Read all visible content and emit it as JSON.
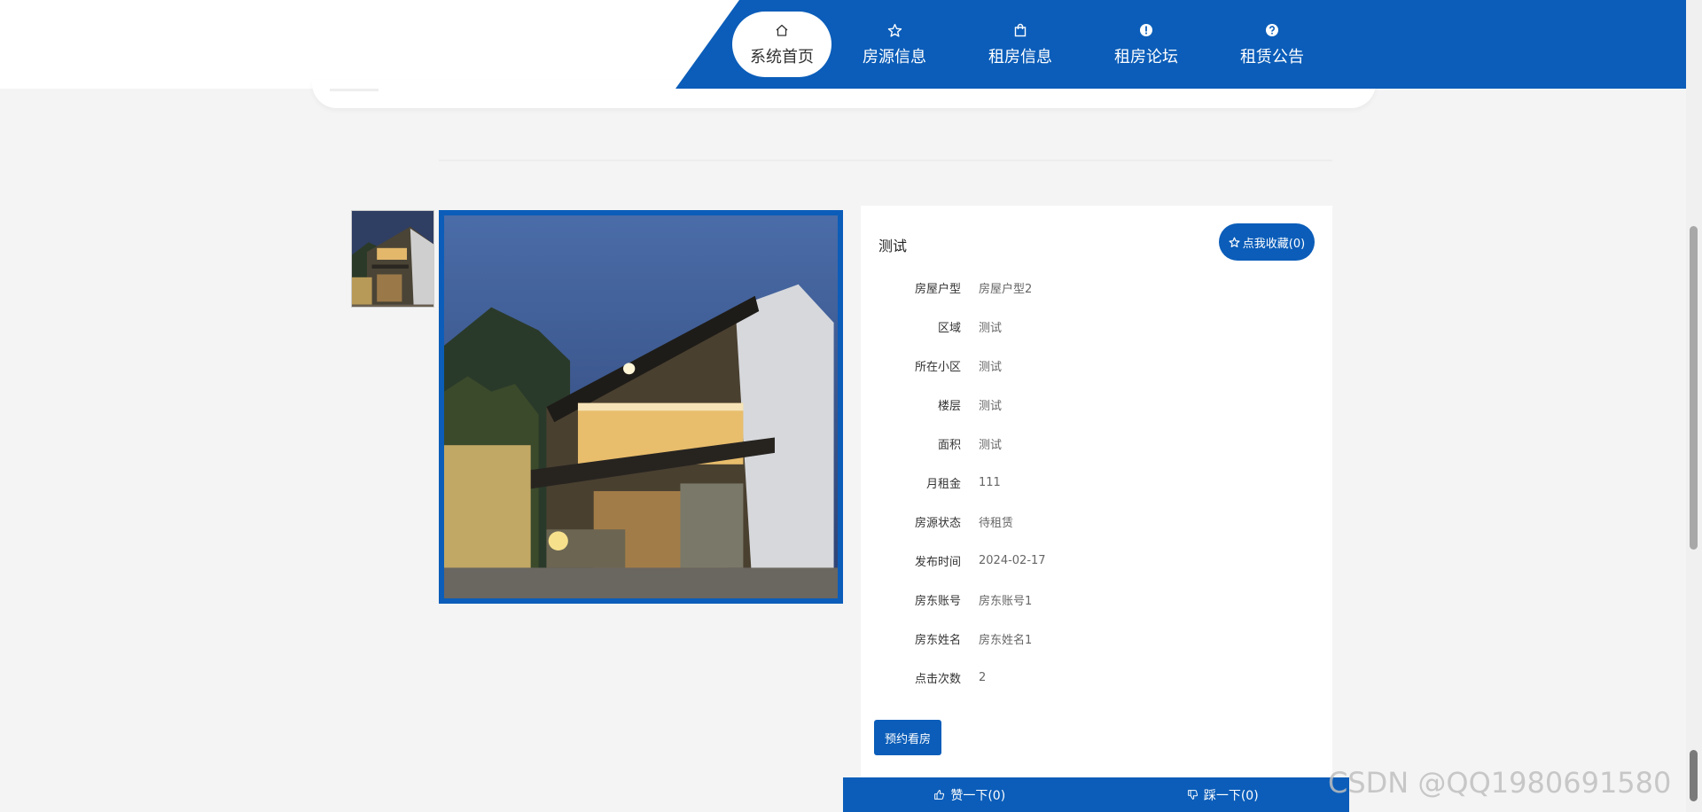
{
  "nav": {
    "items": [
      {
        "label": "系统首页",
        "icon": "home-icon"
      },
      {
        "label": "房源信息",
        "icon": "star-icon"
      },
      {
        "label": "租房信息",
        "icon": "bag-icon"
      },
      {
        "label": "租房论坛",
        "icon": "alert-icon"
      },
      {
        "label": "租赁公告",
        "icon": "help-icon"
      }
    ],
    "active_index": 0
  },
  "property": {
    "title": "测试",
    "favorite_label": "点我收藏(0)",
    "fields": [
      {
        "key": "房屋户型",
        "value": "房屋户型2"
      },
      {
        "key": "区域",
        "value": "测试"
      },
      {
        "key": "所在小区",
        "value": "测试"
      },
      {
        "key": "楼层",
        "value": "测试"
      },
      {
        "key": "面积",
        "value": "测试"
      },
      {
        "key": "月租金",
        "value": "111"
      },
      {
        "key": "房源状态",
        "value": "待租赁"
      },
      {
        "key": "发布时间",
        "value": "2024-02-17"
      },
      {
        "key": "房东账号",
        "value": "房东账号1"
      },
      {
        "key": "房东姓名",
        "value": "房东姓名1"
      },
      {
        "key": "点击次数",
        "value": "2"
      }
    ],
    "book_label": "预约看房"
  },
  "votes": {
    "like_label": "赞一下(0)",
    "dislike_label": "踩一下(0)"
  },
  "watermark": "CSDN @QQ1980691580",
  "colors": {
    "primary": "#0b5db9",
    "background": "#f4f4f4"
  }
}
